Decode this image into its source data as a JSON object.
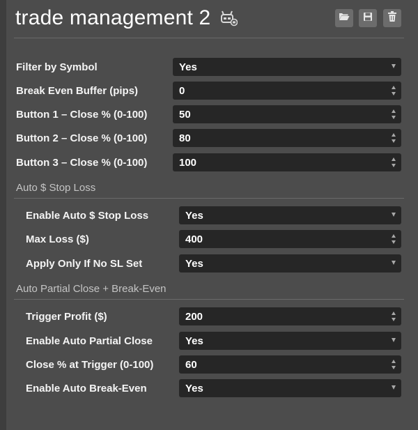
{
  "header": {
    "title": "trade management 2",
    "icons": [
      "robot-icon",
      "folder-open-icon",
      "save-icon",
      "trash-icon"
    ]
  },
  "general": [
    {
      "label": "Filter by Symbol",
      "value": "Yes",
      "type": "select"
    },
    {
      "label": "Break Even Buffer (pips)",
      "value": "0",
      "type": "number"
    },
    {
      "label": "Button 1 – Close % (0-100)",
      "value": "50",
      "type": "number"
    },
    {
      "label": "Button 2 – Close % (0-100)",
      "value": "80",
      "type": "number"
    },
    {
      "label": "Button 3 – Close % (0-100)",
      "value": "100",
      "type": "number"
    }
  ],
  "auto_sl": {
    "title": "Auto $ Stop Loss",
    "fields": [
      {
        "label": "Enable Auto $ Stop Loss",
        "value": "Yes",
        "type": "select"
      },
      {
        "label": "Max Loss ($)",
        "value": "400",
        "type": "number"
      },
      {
        "label": "Apply Only If No SL Set",
        "value": "Yes",
        "type": "select"
      }
    ]
  },
  "auto_partial": {
    "title": "Auto Partial Close + Break-Even",
    "fields": [
      {
        "label": "Trigger Profit ($)",
        "value": "200",
        "type": "number"
      },
      {
        "label": "Enable Auto Partial Close",
        "value": "Yes",
        "type": "select"
      },
      {
        "label": "Close % at Trigger (0-100)",
        "value": "60",
        "type": "number"
      },
      {
        "label": "Enable Auto Break-Even",
        "value": "Yes",
        "type": "select"
      }
    ]
  },
  "colors": {
    "background": "#4c4c4c",
    "field": "#262626",
    "header_button": "#6c6c6c",
    "section_title": "#c4c4c4"
  }
}
